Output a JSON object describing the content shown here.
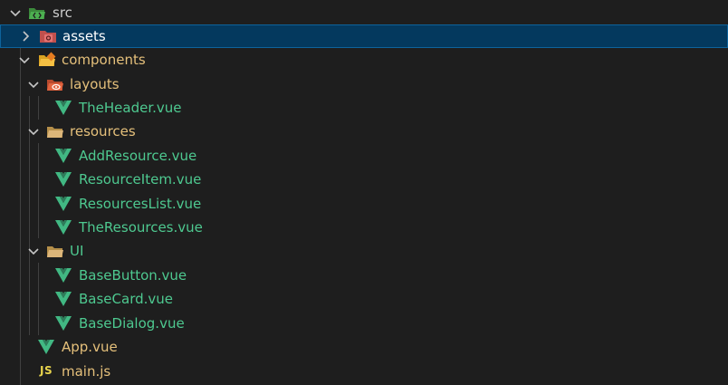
{
  "tree": {
    "src": {
      "label": "src",
      "icon": "folder-src-open-icon",
      "expanded": true
    },
    "assets": {
      "label": "assets",
      "icon": "folder-assets-icon",
      "expanded": false,
      "selected": true
    },
    "components": {
      "label": "components",
      "icon": "folder-components-open-icon",
      "expanded": true
    },
    "layouts": {
      "label": "layouts",
      "icon": "folder-layouts-open-icon",
      "expanded": true
    },
    "the_header": {
      "label": "TheHeader.vue",
      "icon": "vue-file-icon"
    },
    "resources": {
      "label": "resources",
      "icon": "folder-open-icon",
      "expanded": true
    },
    "add_resource": {
      "label": "AddResource.vue",
      "icon": "vue-file-icon"
    },
    "resource_item": {
      "label": "ResourceItem.vue",
      "icon": "vue-file-icon"
    },
    "resources_list": {
      "label": "ResourcesList.vue",
      "icon": "vue-file-icon"
    },
    "the_resources": {
      "label": "TheResources.vue",
      "icon": "vue-file-icon"
    },
    "ui": {
      "label": "UI",
      "icon": "folder-open-icon",
      "expanded": true
    },
    "base_button": {
      "label": "BaseButton.vue",
      "icon": "vue-file-icon"
    },
    "base_card": {
      "label": "BaseCard.vue",
      "icon": "vue-file-icon"
    },
    "base_dialog": {
      "label": "BaseDialog.vue",
      "icon": "vue-file-icon"
    },
    "app_vue": {
      "label": "App.vue",
      "icon": "vue-file-icon"
    },
    "main_js": {
      "label": "main.js",
      "icon": "js-file-icon",
      "icon_text": "JS"
    }
  },
  "colors": {
    "background": "#1e1e1e",
    "selection": "#04395e",
    "selection_border": "#0e639c",
    "vue_text": "#4ec990",
    "vue_icon": "#41b883",
    "modified_text": "#e5c07b",
    "js_icon": "#e8d44d",
    "folder_text": "#cccccc"
  }
}
